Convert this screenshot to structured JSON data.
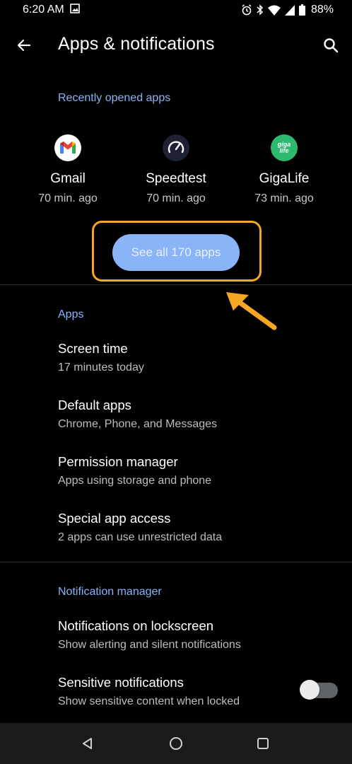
{
  "status_bar": {
    "time": "6:20 AM",
    "battery": "88%",
    "icons": [
      "image-icon",
      "alarm-icon",
      "bluetooth-icon",
      "wifi-icon",
      "signal-icon",
      "battery-icon"
    ]
  },
  "app_bar": {
    "title": "Apps & notifications",
    "back_icon": "back-arrow-icon",
    "search_icon": "search-icon"
  },
  "recent": {
    "header": "Recently opened apps",
    "apps": [
      {
        "name": "Gmail",
        "time": "70 min. ago",
        "icon": "gmail-icon"
      },
      {
        "name": "Speedtest",
        "time": "70 min. ago",
        "icon": "speedtest-icon"
      },
      {
        "name": "GigaLife",
        "time": "73 min. ago",
        "icon": "gigalife-icon",
        "icon_text": "giga life"
      }
    ],
    "see_all_label": "See all 170 apps"
  },
  "apps_section": {
    "header": "Apps",
    "items": [
      {
        "title": "Screen time",
        "summary": "17 minutes today"
      },
      {
        "title": "Default apps",
        "summary": "Chrome, Phone, and Messages"
      },
      {
        "title": "Permission manager",
        "summary": "Apps using storage and phone"
      },
      {
        "title": "Special app access",
        "summary": "2 apps can use unrestricted data"
      }
    ]
  },
  "notification_section": {
    "header": "Notification manager",
    "items": [
      {
        "title": "Notifications on lockscreen",
        "summary": "Show alerting and silent notifications"
      },
      {
        "title": "Sensitive notifications",
        "summary": "Show sensitive content when locked",
        "toggle_on": false
      }
    ]
  },
  "colors": {
    "accent": "#8ab4f8",
    "highlight": "#f5a623",
    "background": "#000000"
  },
  "nav_bar": {
    "buttons": [
      "back-triangle-icon",
      "home-circle-icon",
      "recents-square-icon"
    ]
  }
}
